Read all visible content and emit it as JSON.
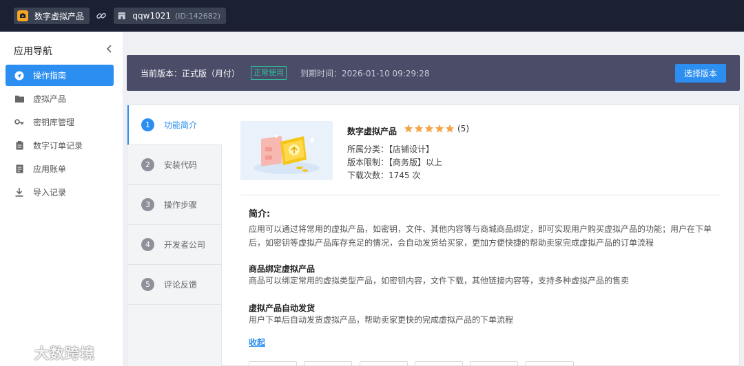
{
  "topbar": {
    "app_name": "数字虚拟产品",
    "store_name": "qqw1021",
    "store_id": "(ID:142682)"
  },
  "sidebar": {
    "title": "应用导航",
    "items": [
      {
        "label": "操作指南",
        "icon": "send-icon",
        "active": true
      },
      {
        "label": "虚拟产品",
        "icon": "folder-icon",
        "active": false
      },
      {
        "label": "密钥库管理",
        "icon": "key-icon",
        "active": false
      },
      {
        "label": "数字订单记录",
        "icon": "clipboard-icon",
        "active": false
      },
      {
        "label": "应用账单",
        "icon": "document-icon",
        "active": false
      },
      {
        "label": "导入记录",
        "icon": "download-icon",
        "active": false
      }
    ]
  },
  "watermark": {
    "text": "大数跨境"
  },
  "banner": {
    "version": "当前版本：正式版（月付）",
    "status": "正常使用",
    "expiry": "到期时间：2026-01-10 09:29:28",
    "select_button": "选择版本"
  },
  "steps": [
    {
      "num": "1",
      "label": "功能简介",
      "active": true
    },
    {
      "num": "2",
      "label": "安装代码",
      "active": false
    },
    {
      "num": "3",
      "label": "操作步骤",
      "active": false
    },
    {
      "num": "4",
      "label": "开发者公司",
      "active": false
    },
    {
      "num": "5",
      "label": "评论反馈",
      "active": false
    }
  ],
  "product": {
    "name": "数字虚拟产品",
    "rating": 5,
    "rating_count": "(5)",
    "category": "所属分类：【店铺设计】",
    "version_limit": "版本限制：【商务版】以上",
    "downloads": "下载次数：1745 次"
  },
  "content": {
    "intro_title": "简介:",
    "intro_text": "应用可以通过将常用的虚拟产品，如密钥，文件、其他内容等与商城商品绑定，即可实现用户购买虚拟产品的功能；用户在下单后，如密钥等虚拟产品库存充足的情况，会自动发货给买家，更加方便快捷的帮助卖家完成虚拟产品的订单流程",
    "section1_title": "商品绑定虚拟产品",
    "section1_text": "商品可以绑定常用的虚拟类型产品，如密钥内容，文件下载，其他链接内容等，支持多种虚拟产品的售卖",
    "section2_title": "虚拟产品自动发货",
    "section2_text": "用户下单后自动发货虚拟产品，帮助卖家更快的完成虚拟产品的下单流程",
    "collapse_link": "收起"
  },
  "colors": {
    "accent": "#2b8ef0",
    "topbar_bg": "#1b2133",
    "banner_bg": "#4a4c68",
    "status_green": "#2fbf9f",
    "star": "#f5a54a"
  }
}
